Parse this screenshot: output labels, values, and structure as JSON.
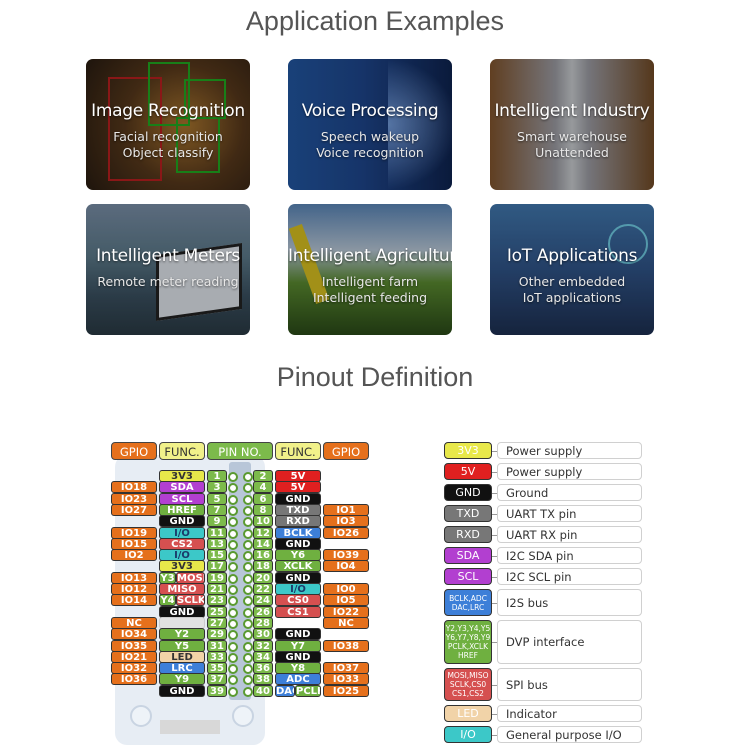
{
  "sections": {
    "applications_title": "Application Examples",
    "pinout_title": "Pinout Definition"
  },
  "applications": [
    {
      "title": "Image Recognition",
      "lines": [
        "Facial recognition",
        "Object classify"
      ]
    },
    {
      "title": "Voice Processing",
      "lines": [
        "Speech wakeup",
        "Voice recognition"
      ]
    },
    {
      "title": "Intelligent Industry",
      "lines": [
        "Smart warehouse",
        "Unattended"
      ]
    },
    {
      "title": "Intelligent Meters",
      "lines": [
        "Remote meter reading"
      ]
    },
    {
      "title": "Intelligent Agriculture",
      "lines": [
        "Intelligent farm",
        "Intelligent feeding"
      ]
    },
    {
      "title": "IoT Applications",
      "lines": [
        "Other embedded",
        "IoT applications"
      ]
    }
  ],
  "pinout": {
    "headers": {
      "gpio_left": "GPIO",
      "func_left": "FUNC.",
      "pin_no": "PIN NO.",
      "func_right": "FUNC.",
      "gpio_right": "GPIO"
    },
    "rows": [
      {
        "lg": "",
        "lf": [
          {
            "t": "3V3",
            "c": "3v3"
          }
        ],
        "lp": "1",
        "rp": "2",
        "rf": [
          {
            "t": "5V",
            "c": "5v"
          }
        ],
        "rg": ""
      },
      {
        "lg": "IO18",
        "lf": [
          {
            "t": "SDA",
            "c": "i2c"
          }
        ],
        "lp": "3",
        "rp": "4",
        "rf": [
          {
            "t": "5V",
            "c": "5v"
          }
        ],
        "rg": ""
      },
      {
        "lg": "IO23",
        "lf": [
          {
            "t": "SCL",
            "c": "i2c"
          }
        ],
        "lp": "5",
        "rp": "6",
        "rf": [
          {
            "t": "GND",
            "c": "gnd"
          }
        ],
        "rg": ""
      },
      {
        "lg": "IO27",
        "lf": [
          {
            "t": "HREF",
            "c": "dvp"
          }
        ],
        "lp": "7",
        "rp": "8",
        "rf": [
          {
            "t": "TXD",
            "c": "uart"
          }
        ],
        "rg": "IO1"
      },
      {
        "lg": "",
        "lf": [
          {
            "t": "GND",
            "c": "gnd"
          }
        ],
        "lp": "9",
        "rp": "10",
        "rf": [
          {
            "t": "RXD",
            "c": "uart"
          }
        ],
        "rg": "IO3"
      },
      {
        "lg": "IO19",
        "lf": [
          {
            "t": "I/O",
            "c": "io"
          }
        ],
        "lp": "11",
        "rp": "12",
        "rf": [
          {
            "t": "BCLK",
            "c": "i2s"
          }
        ],
        "rg": "IO26"
      },
      {
        "lg": "IO15",
        "lf": [
          {
            "t": "CS2",
            "c": "spi"
          }
        ],
        "lp": "13",
        "rp": "14",
        "rf": [
          {
            "t": "GND",
            "c": "gnd"
          }
        ],
        "rg": ""
      },
      {
        "lg": "IO2",
        "lf": [
          {
            "t": "I/O",
            "c": "io"
          }
        ],
        "lp": "15",
        "rp": "16",
        "rf": [
          {
            "t": "Y6",
            "c": "dvp"
          }
        ],
        "rg": "IO39"
      },
      {
        "lg": "",
        "lf": [
          {
            "t": "3V3",
            "c": "3v3"
          }
        ],
        "lp": "17",
        "rp": "18",
        "rf": [
          {
            "t": "XCLK",
            "c": "dvp"
          }
        ],
        "rg": "IO4"
      },
      {
        "lg": "IO13",
        "lf": [
          {
            "t": "Y3",
            "c": "dvp"
          },
          {
            "t": "MOSI",
            "c": "spi"
          }
        ],
        "lp": "19",
        "rp": "20",
        "rf": [
          {
            "t": "GND",
            "c": "gnd"
          }
        ],
        "rg": ""
      },
      {
        "lg": "IO12",
        "lf": [
          {
            "t": "MISO",
            "c": "spi"
          }
        ],
        "lp": "21",
        "rp": "22",
        "rf": [
          {
            "t": "I/O",
            "c": "io"
          }
        ],
        "rg": "IO0"
      },
      {
        "lg": "IO14",
        "lf": [
          {
            "t": "Y4",
            "c": "dvp"
          },
          {
            "t": "SCLK",
            "c": "spi"
          }
        ],
        "lp": "23",
        "rp": "24",
        "rf": [
          {
            "t": "CS0",
            "c": "spi"
          }
        ],
        "rg": "IO5"
      },
      {
        "lg": "",
        "lf": [
          {
            "t": "GND",
            "c": "gnd"
          }
        ],
        "lp": "25",
        "rp": "26",
        "rf": [
          {
            "t": "CS1",
            "c": "spi"
          }
        ],
        "rg": "IO22"
      },
      {
        "lg": "NC",
        "lf": [
          {
            "t": "",
            "c": "nc2"
          }
        ],
        "lp": "27",
        "rp": "28",
        "rf": [],
        "rg": "NC"
      },
      {
        "lg": "IO34",
        "lf": [
          {
            "t": "Y2",
            "c": "dvp"
          }
        ],
        "lp": "29",
        "rp": "30",
        "rf": [
          {
            "t": "GND",
            "c": "gnd"
          }
        ],
        "rg": ""
      },
      {
        "lg": "IO35",
        "lf": [
          {
            "t": "Y5",
            "c": "dvp"
          }
        ],
        "lp": "31",
        "rp": "32",
        "rf": [
          {
            "t": "Y7",
            "c": "dvp"
          }
        ],
        "rg": "IO38"
      },
      {
        "lg": "IO21",
        "lf": [
          {
            "t": "LED",
            "c": "led"
          }
        ],
        "lp": "33",
        "rp": "34",
        "rf": [
          {
            "t": "GND",
            "c": "gnd"
          }
        ],
        "rg": ""
      },
      {
        "lg": "IO32",
        "lf": [
          {
            "t": "LRC",
            "c": "i2s"
          }
        ],
        "lp": "35",
        "rp": "36",
        "rf": [
          {
            "t": "Y8",
            "c": "dvp"
          }
        ],
        "rg": "IO37"
      },
      {
        "lg": "IO36",
        "lf": [
          {
            "t": "Y9",
            "c": "dvp"
          }
        ],
        "lp": "37",
        "rp": "38",
        "rf": [
          {
            "t": "ADC",
            "c": "i2s"
          }
        ],
        "rg": "IO33"
      },
      {
        "lg": "",
        "lf": [
          {
            "t": "GND",
            "c": "gnd"
          }
        ],
        "lp": "39",
        "rp": "40",
        "rf": [
          {
            "t": "DAC",
            "c": "i2s"
          },
          {
            "t": "PCLK",
            "c": "dvp"
          }
        ],
        "rg": "IO25"
      }
    ]
  },
  "legend": [
    {
      "badge": "3V3",
      "c": "3v3",
      "text": "Power supply"
    },
    {
      "badge": "5V",
      "c": "5v",
      "text": "Power supply"
    },
    {
      "badge": "GND",
      "c": "gnd",
      "text": "Ground"
    },
    {
      "badge": "TXD",
      "c": "uart",
      "text": "UART TX pin"
    },
    {
      "badge": "RXD",
      "c": "uart",
      "text": "UART RX pin"
    },
    {
      "badge": "SDA",
      "c": "i2c",
      "text": "I2C SDA pin"
    },
    {
      "badge": "SCL",
      "c": "i2c",
      "text": "I2C SCL pin"
    },
    {
      "badge": "BCLK,ADC DAC,LRC",
      "c": "i2s",
      "text": "I2S bus"
    },
    {
      "badge": "Y2,Y3,Y4,Y5 Y6,Y7,Y8,Y9 PCLK,XCLK HREF",
      "c": "dvp",
      "text": "DVP interface"
    },
    {
      "badge": "MOSI,MISO SCLK,CS0 CS1,CS2",
      "c": "spi",
      "text": "SPI bus"
    },
    {
      "badge": "LED",
      "c": "led",
      "text": "Indicator"
    },
    {
      "badge": "I/O",
      "c": "io",
      "text": "General purpose I/O"
    }
  ]
}
